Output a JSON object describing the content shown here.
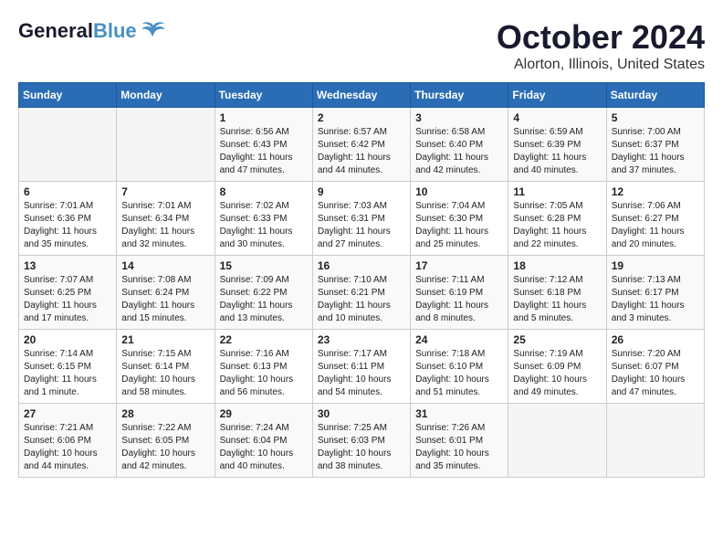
{
  "header": {
    "logo_general": "General",
    "logo_blue": "Blue",
    "month": "October 2024",
    "location": "Alorton, Illinois, United States"
  },
  "days_of_week": [
    "Sunday",
    "Monday",
    "Tuesday",
    "Wednesday",
    "Thursday",
    "Friday",
    "Saturday"
  ],
  "weeks": [
    [
      {
        "day": "",
        "sunrise": "",
        "sunset": "",
        "daylight": ""
      },
      {
        "day": "",
        "sunrise": "",
        "sunset": "",
        "daylight": ""
      },
      {
        "day": "1",
        "sunrise": "Sunrise: 6:56 AM",
        "sunset": "Sunset: 6:43 PM",
        "daylight": "Daylight: 11 hours and 47 minutes."
      },
      {
        "day": "2",
        "sunrise": "Sunrise: 6:57 AM",
        "sunset": "Sunset: 6:42 PM",
        "daylight": "Daylight: 11 hours and 44 minutes."
      },
      {
        "day": "3",
        "sunrise": "Sunrise: 6:58 AM",
        "sunset": "Sunset: 6:40 PM",
        "daylight": "Daylight: 11 hours and 42 minutes."
      },
      {
        "day": "4",
        "sunrise": "Sunrise: 6:59 AM",
        "sunset": "Sunset: 6:39 PM",
        "daylight": "Daylight: 11 hours and 40 minutes."
      },
      {
        "day": "5",
        "sunrise": "Sunrise: 7:00 AM",
        "sunset": "Sunset: 6:37 PM",
        "daylight": "Daylight: 11 hours and 37 minutes."
      }
    ],
    [
      {
        "day": "6",
        "sunrise": "Sunrise: 7:01 AM",
        "sunset": "Sunset: 6:36 PM",
        "daylight": "Daylight: 11 hours and 35 minutes."
      },
      {
        "day": "7",
        "sunrise": "Sunrise: 7:01 AM",
        "sunset": "Sunset: 6:34 PM",
        "daylight": "Daylight: 11 hours and 32 minutes."
      },
      {
        "day": "8",
        "sunrise": "Sunrise: 7:02 AM",
        "sunset": "Sunset: 6:33 PM",
        "daylight": "Daylight: 11 hours and 30 minutes."
      },
      {
        "day": "9",
        "sunrise": "Sunrise: 7:03 AM",
        "sunset": "Sunset: 6:31 PM",
        "daylight": "Daylight: 11 hours and 27 minutes."
      },
      {
        "day": "10",
        "sunrise": "Sunrise: 7:04 AM",
        "sunset": "Sunset: 6:30 PM",
        "daylight": "Daylight: 11 hours and 25 minutes."
      },
      {
        "day": "11",
        "sunrise": "Sunrise: 7:05 AM",
        "sunset": "Sunset: 6:28 PM",
        "daylight": "Daylight: 11 hours and 22 minutes."
      },
      {
        "day": "12",
        "sunrise": "Sunrise: 7:06 AM",
        "sunset": "Sunset: 6:27 PM",
        "daylight": "Daylight: 11 hours and 20 minutes."
      }
    ],
    [
      {
        "day": "13",
        "sunrise": "Sunrise: 7:07 AM",
        "sunset": "Sunset: 6:25 PM",
        "daylight": "Daylight: 11 hours and 17 minutes."
      },
      {
        "day": "14",
        "sunrise": "Sunrise: 7:08 AM",
        "sunset": "Sunset: 6:24 PM",
        "daylight": "Daylight: 11 hours and 15 minutes."
      },
      {
        "day": "15",
        "sunrise": "Sunrise: 7:09 AM",
        "sunset": "Sunset: 6:22 PM",
        "daylight": "Daylight: 11 hours and 13 minutes."
      },
      {
        "day": "16",
        "sunrise": "Sunrise: 7:10 AM",
        "sunset": "Sunset: 6:21 PM",
        "daylight": "Daylight: 11 hours and 10 minutes."
      },
      {
        "day": "17",
        "sunrise": "Sunrise: 7:11 AM",
        "sunset": "Sunset: 6:19 PM",
        "daylight": "Daylight: 11 hours and 8 minutes."
      },
      {
        "day": "18",
        "sunrise": "Sunrise: 7:12 AM",
        "sunset": "Sunset: 6:18 PM",
        "daylight": "Daylight: 11 hours and 5 minutes."
      },
      {
        "day": "19",
        "sunrise": "Sunrise: 7:13 AM",
        "sunset": "Sunset: 6:17 PM",
        "daylight": "Daylight: 11 hours and 3 minutes."
      }
    ],
    [
      {
        "day": "20",
        "sunrise": "Sunrise: 7:14 AM",
        "sunset": "Sunset: 6:15 PM",
        "daylight": "Daylight: 11 hours and 1 minute."
      },
      {
        "day": "21",
        "sunrise": "Sunrise: 7:15 AM",
        "sunset": "Sunset: 6:14 PM",
        "daylight": "Daylight: 10 hours and 58 minutes."
      },
      {
        "day": "22",
        "sunrise": "Sunrise: 7:16 AM",
        "sunset": "Sunset: 6:13 PM",
        "daylight": "Daylight: 10 hours and 56 minutes."
      },
      {
        "day": "23",
        "sunrise": "Sunrise: 7:17 AM",
        "sunset": "Sunset: 6:11 PM",
        "daylight": "Daylight: 10 hours and 54 minutes."
      },
      {
        "day": "24",
        "sunrise": "Sunrise: 7:18 AM",
        "sunset": "Sunset: 6:10 PM",
        "daylight": "Daylight: 10 hours and 51 minutes."
      },
      {
        "day": "25",
        "sunrise": "Sunrise: 7:19 AM",
        "sunset": "Sunset: 6:09 PM",
        "daylight": "Daylight: 10 hours and 49 minutes."
      },
      {
        "day": "26",
        "sunrise": "Sunrise: 7:20 AM",
        "sunset": "Sunset: 6:07 PM",
        "daylight": "Daylight: 10 hours and 47 minutes."
      }
    ],
    [
      {
        "day": "27",
        "sunrise": "Sunrise: 7:21 AM",
        "sunset": "Sunset: 6:06 PM",
        "daylight": "Daylight: 10 hours and 44 minutes."
      },
      {
        "day": "28",
        "sunrise": "Sunrise: 7:22 AM",
        "sunset": "Sunset: 6:05 PM",
        "daylight": "Daylight: 10 hours and 42 minutes."
      },
      {
        "day": "29",
        "sunrise": "Sunrise: 7:24 AM",
        "sunset": "Sunset: 6:04 PM",
        "daylight": "Daylight: 10 hours and 40 minutes."
      },
      {
        "day": "30",
        "sunrise": "Sunrise: 7:25 AM",
        "sunset": "Sunset: 6:03 PM",
        "daylight": "Daylight: 10 hours and 38 minutes."
      },
      {
        "day": "31",
        "sunrise": "Sunrise: 7:26 AM",
        "sunset": "Sunset: 6:01 PM",
        "daylight": "Daylight: 10 hours and 35 minutes."
      },
      {
        "day": "",
        "sunrise": "",
        "sunset": "",
        "daylight": ""
      },
      {
        "day": "",
        "sunrise": "",
        "sunset": "",
        "daylight": ""
      }
    ]
  ]
}
